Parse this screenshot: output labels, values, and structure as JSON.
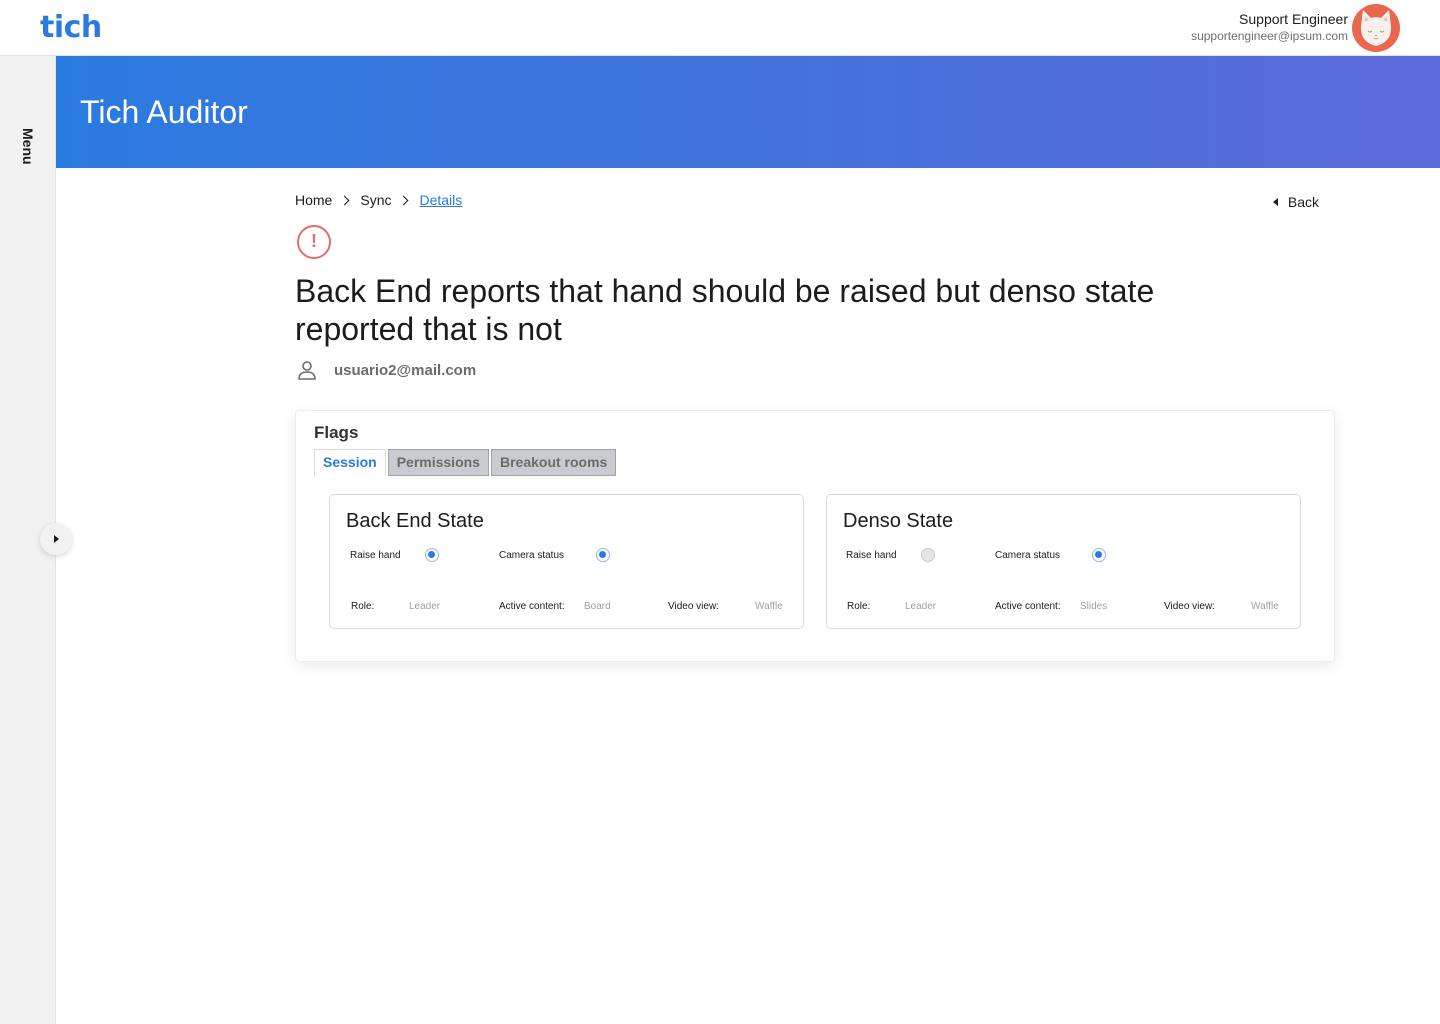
{
  "brand": {
    "logo": "tich",
    "accent": "#2a7be0"
  },
  "user": {
    "name": "Support Engineer",
    "email": "supportengineer@ipsum.com"
  },
  "sidebar": {
    "menu_label": "Menu"
  },
  "banner": {
    "title": "Tich Auditor"
  },
  "breadcrumb": {
    "items": [
      "Home",
      "Sync",
      "Details"
    ]
  },
  "back": {
    "label": "Back"
  },
  "alert": {
    "icon": "alert-circle-icon",
    "glyph": "!",
    "color": "#e86a6a"
  },
  "issue": {
    "title": "Back End reports that hand should be raised but denso state reported that is not",
    "user_email": "usuario2@mail.com"
  },
  "flags": {
    "title": "Flags",
    "tabs": [
      {
        "label": "Session",
        "active": true
      },
      {
        "label": "Permissions",
        "active": false
      },
      {
        "label": "Breakout rooms",
        "active": false
      }
    ],
    "states": [
      {
        "title": "Back End State",
        "raise_hand_label": "Raise hand",
        "raise_hand": true,
        "camera_label": "Camera status",
        "camera": true,
        "role_label": "Role:",
        "role": "Leader",
        "content_label": "Active content:",
        "content": "Board",
        "view_label": "Video view:",
        "view": "Waffle"
      },
      {
        "title": "Denso State",
        "raise_hand_label": "Raise hand",
        "raise_hand": false,
        "camera_label": "Camera status",
        "camera": true,
        "role_label": "Role:",
        "role": "Leader",
        "content_label": "Active content:",
        "content": "Slides",
        "view_label": "Video view:",
        "view": "Waffle"
      }
    ]
  }
}
